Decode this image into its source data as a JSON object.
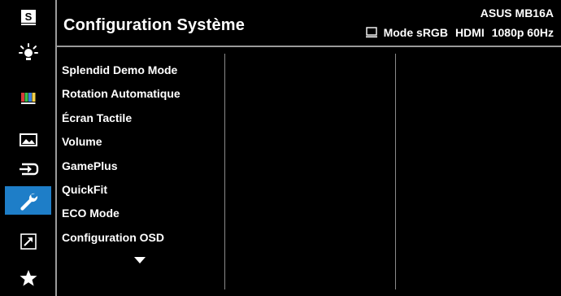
{
  "header": {
    "title": "Configuration Système",
    "model": "ASUS MB16A",
    "status": {
      "icon": "monitor-icon",
      "mode": "Mode sRGB",
      "input": "HDMI",
      "resolution": "1080p 60Hz"
    }
  },
  "rail": {
    "items": [
      {
        "name": "splendid-s-icon",
        "active": false
      },
      {
        "name": "blue-light-filter-icon",
        "active": false
      },
      {
        "name": "color-bars-icon",
        "active": false
      },
      {
        "name": "image-icon",
        "active": false
      },
      {
        "name": "input-select-icon",
        "active": false
      },
      {
        "name": "wrench-icon",
        "active": true
      },
      {
        "name": "shortcut-icon",
        "active": false
      },
      {
        "name": "star-icon",
        "active": false
      }
    ],
    "s_label": "S"
  },
  "menu": {
    "items": [
      "Splendid Demo Mode",
      "Rotation Automatique",
      "Écran Tactile",
      "Volume",
      "GamePlus",
      "QuickFit",
      "ECO Mode",
      "Configuration OSD"
    ],
    "more_icon": "triangle-down-icon"
  },
  "colors": {
    "background": "#000000",
    "accent": "#1e7ec8",
    "divider": "#9a9a9a",
    "text": "#ffffff"
  }
}
